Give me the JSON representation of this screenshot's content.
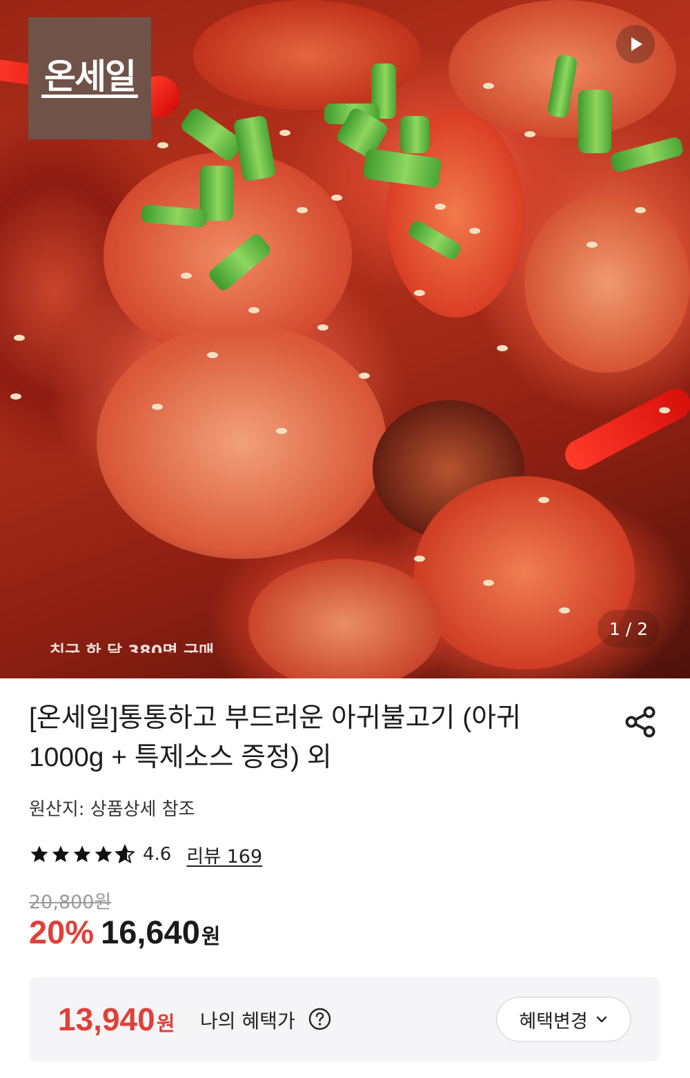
{
  "hero": {
    "logo_text": "온세일",
    "page_indicator": "1 / 2",
    "caption_partial": "친구 한 달 380명 구매"
  },
  "product": {
    "title": "[온세일]통통하고 부드러운 아귀불고기 (아귀 1000g + 특제소스 증정) 외",
    "origin": "원산지: 상품상세 참조",
    "rating": {
      "score": "4.6",
      "stars": 4.6,
      "review_link": "리뷰 169"
    },
    "original_price": "20,800원",
    "discount": "20%",
    "price": "16,640",
    "price_unit": "원"
  },
  "benefit": {
    "amount": "13,940",
    "unit": "원",
    "label": "나의 혜택가",
    "change_button": "혜택변경"
  },
  "icons": {
    "play": "play-icon",
    "share": "share-icon",
    "star": "star-icon",
    "help": "question-circle-icon",
    "chevron": "chevron-down-icon"
  },
  "colors": {
    "accent_red": "#e0403a",
    "logo_bg": "#6f5348",
    "panel_bg": "#f5f5f7"
  }
}
